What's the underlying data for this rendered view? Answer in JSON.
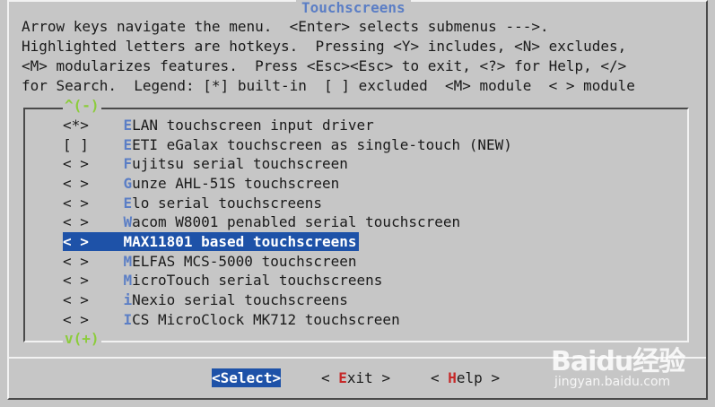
{
  "title": "Touchscreens",
  "help_lines": [
    "Arrow keys navigate the menu.  <Enter> selects submenus --->.",
    "Highlighted letters are hotkeys.  Pressing <Y> includes, <N> excludes,",
    "<M> modularizes features.  Press <Esc><Esc> to exit, <?> for Help, </>",
    "for Search.  Legend: [*] built-in  [ ] excluded  <M> module  < > module"
  ],
  "scroll_up": "^(-)",
  "scroll_down": "v(+)",
  "items": [
    {
      "state": "<*>",
      "hotkey": "E",
      "rest": "LAN touchscreen input driver"
    },
    {
      "state": "[ ]",
      "hotkey": "E",
      "rest": "ETI eGalax touchscreen as single-touch (NEW)"
    },
    {
      "state": "< >",
      "hotkey": "F",
      "rest": "ujitsu serial touchscreen"
    },
    {
      "state": "< >",
      "hotkey": "G",
      "rest": "unze AHL-51S touchscreen"
    },
    {
      "state": "< >",
      "hotkey": "E",
      "rest": "lo serial touchscreens"
    },
    {
      "state": "< >",
      "hotkey": "W",
      "rest": "acom W8001 penabled serial touchscreen"
    },
    {
      "state": "< >",
      "hotkey": "M",
      "rest": "AX11801 based touchscreens"
    },
    {
      "state": "< >",
      "hotkey": "M",
      "rest": "ELFAS MCS-5000 touchscreen"
    },
    {
      "state": "< >",
      "hotkey": "M",
      "rest": "icroTouch serial touchscreens"
    },
    {
      "state": "< >",
      "hotkey": "i",
      "rest": "Nexio serial touchscreens"
    },
    {
      "state": "< >",
      "hotkey": "I",
      "rest": "CS MicroClock MK712 touchscreen"
    }
  ],
  "selected_index": 6,
  "buttons": [
    {
      "pre": "<",
      "hotkey": "S",
      "rest": "elect>",
      "selected": true
    },
    {
      "pre": "< ",
      "hotkey": "E",
      "rest": "xit >",
      "selected": false
    },
    {
      "pre": "< ",
      "hotkey": "H",
      "rest": "elp >",
      "selected": false
    }
  ],
  "watermark": {
    "logo": "Baidu经验",
    "url": "jingyan.baidu.com"
  },
  "colors": {
    "background": "#c6c6c6",
    "title": "#5b7ec5",
    "highlight": "#1e52a8",
    "hotkey_menu": "#5b7ec5",
    "hotkey_button": "#c62828",
    "scroll_arrow": "#8ccc3c"
  }
}
